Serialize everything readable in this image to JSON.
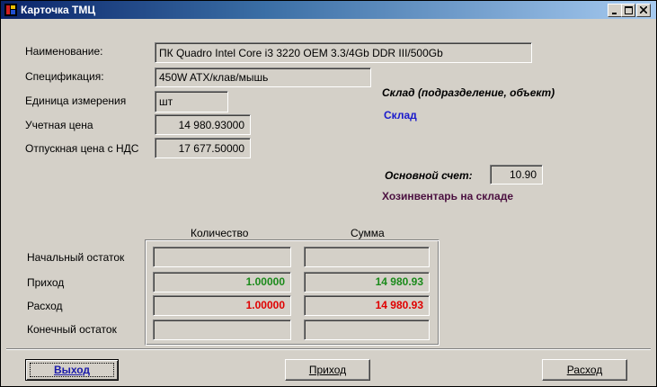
{
  "window": {
    "title": "Карточка ТМЦ"
  },
  "fields": {
    "name_label": "Наименование:",
    "name_value": "ПК Quadro Intel Core i3 3220 OEM 3.3/4Gb DDR III/500Gb",
    "spec_label": "Спецификация:",
    "spec_value": "450W ATX/клав/мышь",
    "unit_label": "Единица измерения",
    "unit_value": "шт",
    "account_price_label": "Учетная цена",
    "account_price_value": "14 980.93000",
    "sale_price_label": "Отпускная цена с НДС",
    "sale_price_value": "17 677.50000"
  },
  "warehouse": {
    "heading": "Склад (подразделение, объект)",
    "name": "Склад",
    "main_account_label": "Основной счет:",
    "main_account_value": "10.90",
    "account_name": "Хозинвентарь на складе"
  },
  "balance": {
    "col_qty": "Количество",
    "col_sum": "Сумма",
    "rows": [
      {
        "label": "Начальный остаток",
        "qty": "",
        "sum": ""
      },
      {
        "label": "Приход",
        "qty": "1.00000",
        "sum": "14 980.93"
      },
      {
        "label": "Расход",
        "qty": "1.00000",
        "sum": "14 980.93"
      },
      {
        "label": "Конечный остаток",
        "qty": "",
        "sum": ""
      }
    ],
    "colors": {
      "income": "#1a8a1a",
      "expense": "#e00000"
    }
  },
  "buttons": {
    "exit": "Выход",
    "income": "Приход",
    "expense": "Расход"
  }
}
